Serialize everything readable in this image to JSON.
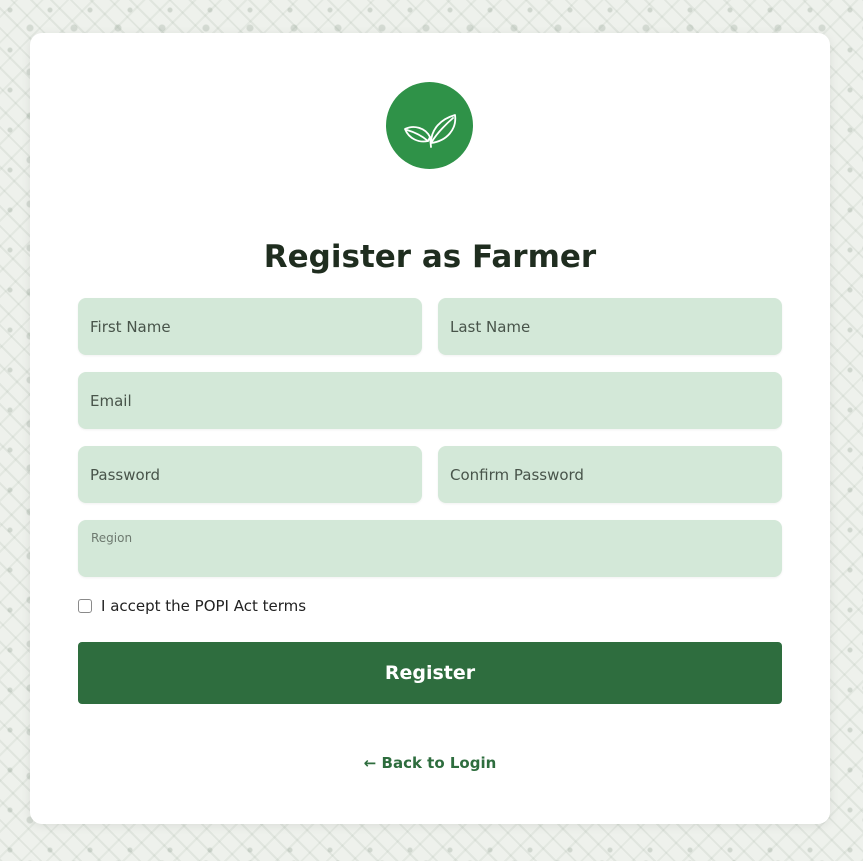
{
  "form": {
    "title": "Register as Farmer",
    "first_name_placeholder": "First Name",
    "last_name_placeholder": "Last Name",
    "email_placeholder": "Email",
    "password_placeholder": "Password",
    "confirm_password_placeholder": "Confirm Password",
    "region_label": "Region",
    "terms_label": "I accept the POPI Act terms",
    "terms_checked": false,
    "register_label": "Register",
    "back_link_label": "← Back to Login"
  },
  "logo": {
    "icon": "leaves-icon",
    "color": "#2f9248"
  },
  "colors": {
    "primary": "#2e6d3e",
    "field_bg": "#d3e8d8",
    "title_text": "#1f2d1f"
  }
}
